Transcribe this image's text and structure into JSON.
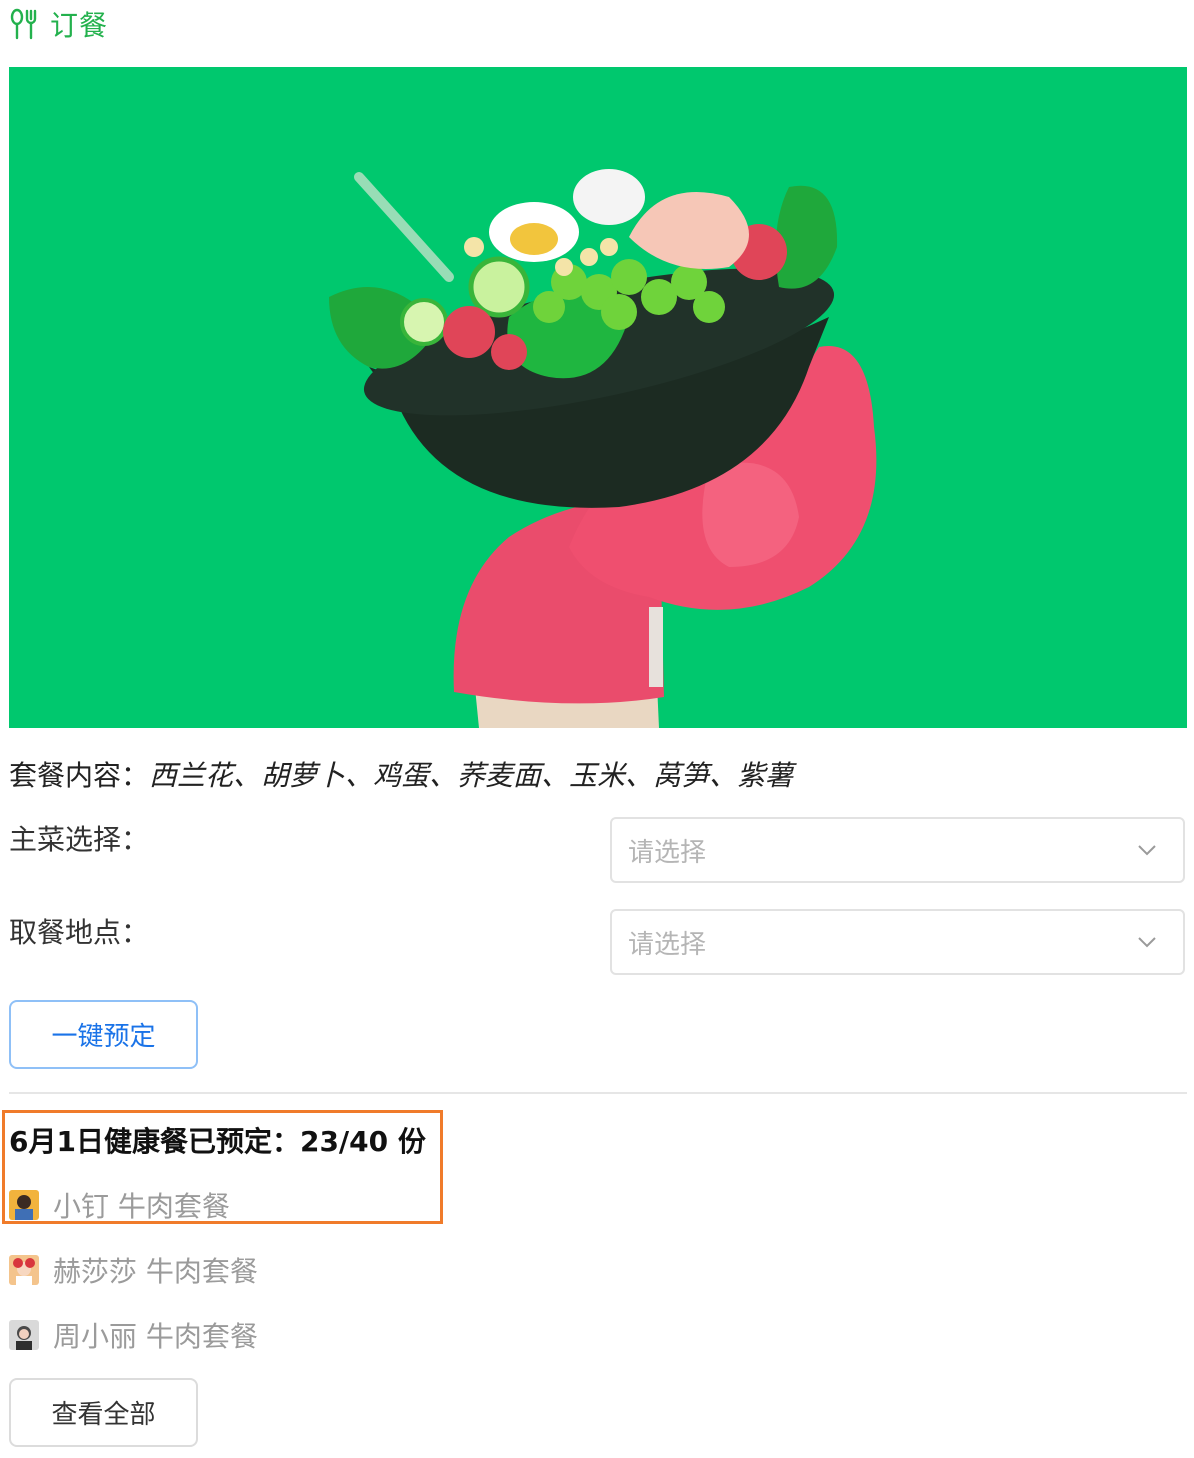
{
  "header": {
    "title": "订餐",
    "icon": "fork-knife-icon",
    "accent_color": "#23b14d"
  },
  "hero": {
    "background_color": "#00c86e",
    "image_subject": "salad bowl held by pink hand"
  },
  "meal": {
    "content_label": "套餐内容：",
    "content_value": "西兰花、胡萝卜、鸡蛋、荞麦面、玉米、莴笋、紫薯"
  },
  "form": {
    "main_dish_label": "主菜选择：",
    "main_dish_placeholder": "请选择",
    "pickup_label": "取餐地点：",
    "pickup_placeholder": "请选择"
  },
  "actions": {
    "reserve_label": "一键预定",
    "view_all_label": "查看全部"
  },
  "booking": {
    "summary": "6月1日健康餐已预定：23/40 份",
    "reservations": [
      {
        "name": "小钉",
        "meal": "牛肉套餐"
      },
      {
        "name": "赫莎莎",
        "meal": "牛肉套餐"
      },
      {
        "name": "周小丽",
        "meal": "牛肉套餐"
      }
    ]
  },
  "colors": {
    "button_text_primary": "#1a73e8",
    "highlight_border": "#f07b2a"
  }
}
